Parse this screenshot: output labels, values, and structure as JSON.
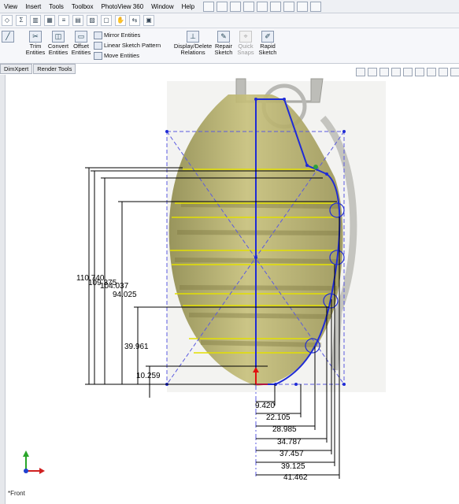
{
  "menu": {
    "items": [
      "View",
      "Insert",
      "Tools",
      "Toolbox",
      "PhotoView 360",
      "Window",
      "Help"
    ]
  },
  "commands": {
    "trim": "Trim Entities",
    "convert": "Convert Entities",
    "offset": "Offset Entities",
    "mirror": "Mirror Entities",
    "linear_pattern": "Linear Sketch Pattern",
    "move": "Move Entities",
    "display_delete": "Display/Delete Relations",
    "repair": "Repair Sketch",
    "quick_snaps": "Quick Snaps",
    "rapid_sketch": "Rapid Sketch"
  },
  "tabs": [
    "DimXpert",
    "Render Tools"
  ],
  "view_label": "*Front",
  "dimensions": {
    "vertical": [
      "110.740",
      "109.375",
      "104.037",
      "94.025",
      "39.961",
      "10.259"
    ],
    "horizontal": [
      "9.420",
      "22.105",
      "28.985",
      "34.787",
      "37.457",
      "39.125",
      "41.462"
    ]
  },
  "colors": {
    "sketch_blue": "#1f2bd6",
    "construction_line": "#5a5ae0",
    "sketch_yellow": "#e3e000",
    "grenade_body": "#b9b06a",
    "dimension_black": "#000000",
    "origin_red": "#e01010"
  },
  "icons": {
    "triad": "axis-triad-icon",
    "circle_constraint": "tangent-circle-icon"
  }
}
